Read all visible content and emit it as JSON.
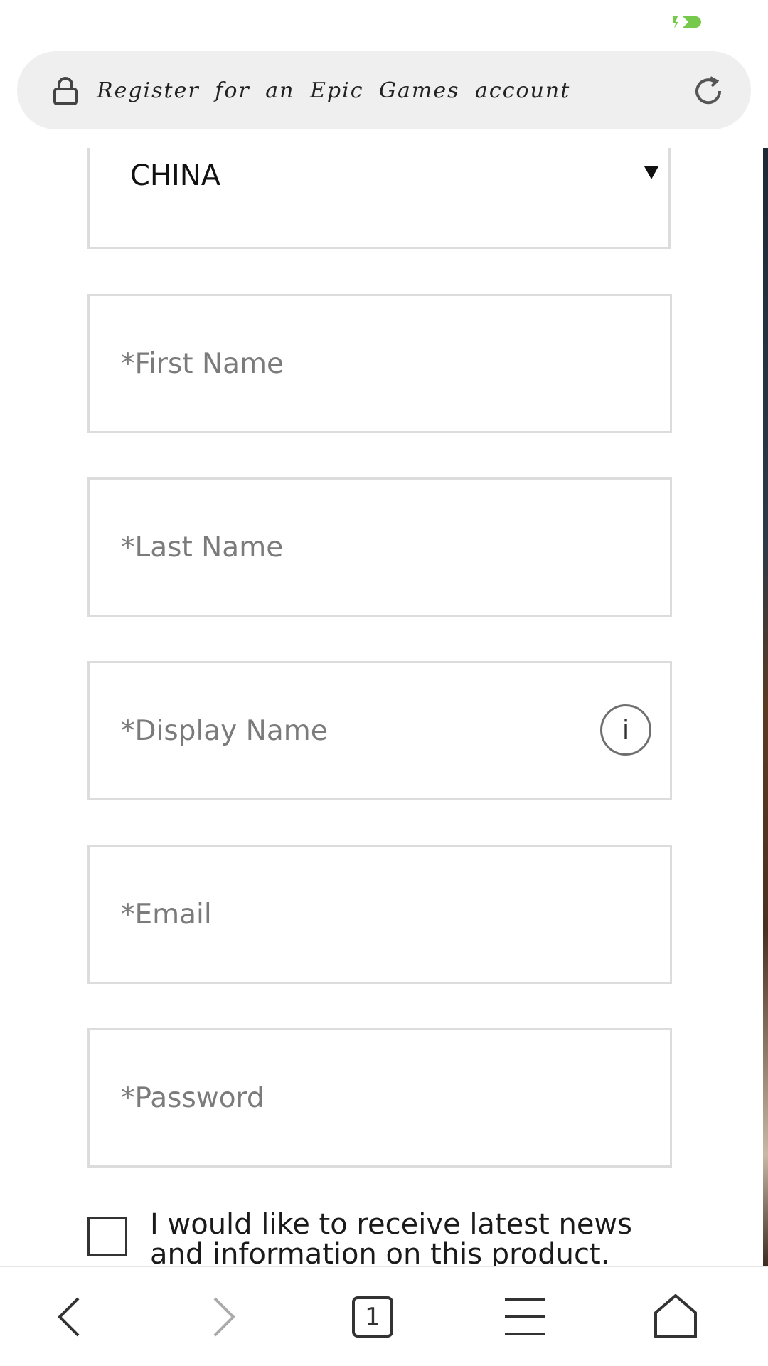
{
  "status_bar": {
    "indicator_icon": "battery-saver-icon",
    "indicator_color": "#76c94a"
  },
  "address_bar": {
    "title": "Register for an Epic Games account",
    "lock_icon": "lock-icon",
    "reload_icon": "reload-icon"
  },
  "form": {
    "country": {
      "value": "CHINA",
      "icon": "dropdown-arrow-icon"
    },
    "first_name": {
      "placeholder": "*First Name",
      "value": ""
    },
    "last_name": {
      "placeholder": "*Last Name",
      "value": ""
    },
    "display_name": {
      "placeholder": "*Display Name",
      "value": "",
      "info_label": "i"
    },
    "email": {
      "placeholder": "*Email",
      "value": ""
    },
    "password": {
      "placeholder": "*Password",
      "value": ""
    },
    "newsletter": {
      "checked": false,
      "label": "I would like to receive latest news and information on this product."
    }
  },
  "bottom_nav": {
    "back_icon": "back-arrow-icon",
    "forward_icon": "forward-arrow-icon",
    "tabs_count": "1",
    "menu_icon": "menu-icon",
    "home_icon": "home-icon"
  },
  "colors": {
    "field_border": "#dcdcdc",
    "placeholder": "#7b7b7b",
    "address_bar_bg": "#efefef",
    "nav_icon": "#333333",
    "nav_icon_disabled": "#aaaaaa"
  }
}
